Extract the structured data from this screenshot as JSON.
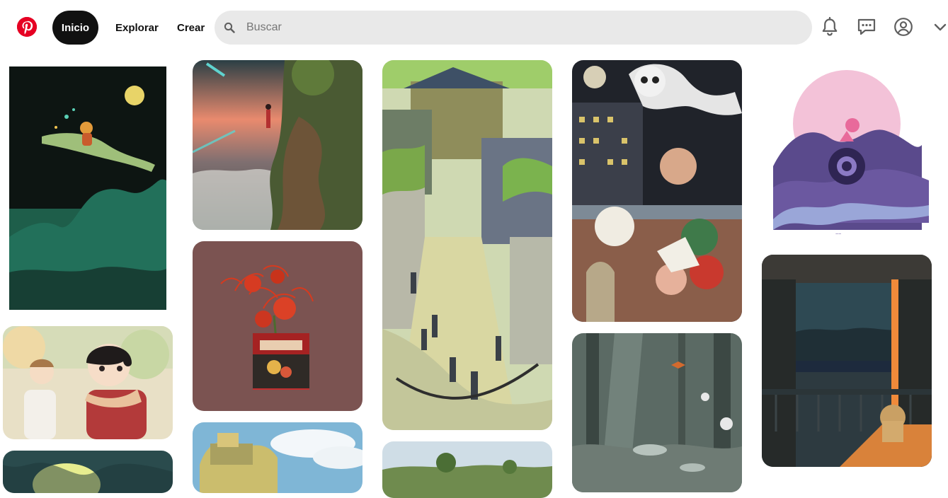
{
  "header": {
    "home_label": "Inicio",
    "explore_label": "Explorar",
    "create_label": "Crear",
    "search_placeholder": "Buscar",
    "icons": [
      "pinterest-logo-icon",
      "search-icon",
      "bell-icon",
      "message-icon",
      "user-profile-icon",
      "chevron-down-icon"
    ]
  },
  "colors": {
    "brand_red": "#e60023",
    "active_nav_bg": "#111111",
    "search_bg": "#e9e9e9"
  },
  "pins": [
    {
      "column": 1,
      "subject": "girl riding dragon under moon artwork"
    },
    {
      "column": 1,
      "subject": "two children in autumn watercolor"
    },
    {
      "column": 1,
      "subject": "dark green creature artwork"
    },
    {
      "column": 2,
      "subject": "girl on cliff at sunset"
    },
    {
      "column": 2,
      "subject": "red spider lily in tin can"
    },
    {
      "column": 2,
      "subject": "floating castle over clouds"
    },
    {
      "column": 3,
      "subject": "japanese town street with stairs"
    },
    {
      "column": 3,
      "subject": "green landscape with trees"
    },
    {
      "column": 4,
      "subject": "yokai and skeleton over city"
    },
    {
      "column": 4,
      "subject": "mossy forest with spirits"
    },
    {
      "column": 5,
      "subject": "girl in purple ocean waves"
    },
    {
      "column": 5,
      "subject": "night balcony with cat"
    }
  ]
}
